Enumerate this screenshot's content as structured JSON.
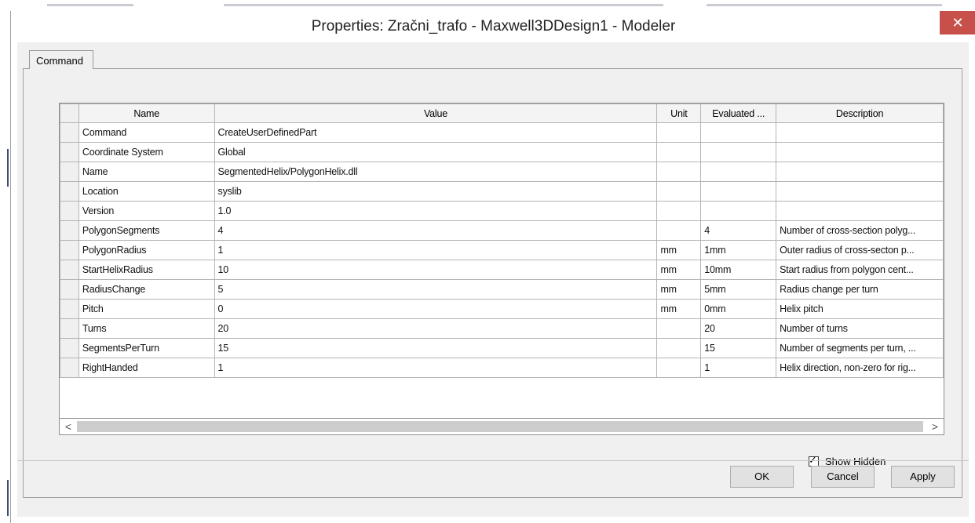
{
  "window": {
    "title": "Properties: Zračni_trafo - Maxwell3DDesign1 - Modeler",
    "close_label": "✕"
  },
  "tabs": [
    {
      "label": "Command",
      "active": true
    }
  ],
  "grid": {
    "columns": [
      "Name",
      "Value",
      "Unit",
      "Evaluated ...",
      "Description"
    ],
    "rows": [
      {
        "name": "Command",
        "value": "CreateUserDefinedPart",
        "unit": "",
        "evaluated": "",
        "description": ""
      },
      {
        "name": "Coordinate System",
        "value": "Global",
        "unit": "",
        "evaluated": "",
        "description": ""
      },
      {
        "name": "Name",
        "value": "SegmentedHelix/PolygonHelix.dll",
        "unit": "",
        "evaluated": "",
        "description": ""
      },
      {
        "name": "Location",
        "value": "syslib",
        "unit": "",
        "evaluated": "",
        "description": ""
      },
      {
        "name": "Version",
        "value": "1.0",
        "unit": "",
        "evaluated": "",
        "description": ""
      },
      {
        "name": "PolygonSegments",
        "value": "4",
        "unit": "",
        "evaluated": "4",
        "description": "Number of cross-section polyg..."
      },
      {
        "name": "PolygonRadius",
        "value": "1",
        "unit": "mm",
        "evaluated": "1mm",
        "description": "Outer radius of cross-secton p..."
      },
      {
        "name": "StartHelixRadius",
        "value": "10",
        "unit": "mm",
        "evaluated": "10mm",
        "description": "Start radius from polygon cent..."
      },
      {
        "name": "RadiusChange",
        "value": "5",
        "unit": "mm",
        "evaluated": "5mm",
        "description": "Radius change per turn"
      },
      {
        "name": "Pitch",
        "value": "0",
        "unit": "mm",
        "evaluated": "0mm",
        "description": "Helix pitch"
      },
      {
        "name": "Turns",
        "value": "20",
        "unit": "",
        "evaluated": "20",
        "description": "Number of turns"
      },
      {
        "name": "SegmentsPerTurn",
        "value": "15",
        "unit": "",
        "evaluated": "15",
        "description": "Number of segments per turn, ..."
      },
      {
        "name": "RightHanded",
        "value": "1",
        "unit": "",
        "evaluated": "1",
        "description": "Helix direction, non-zero for rig..."
      }
    ]
  },
  "scrollbar": {
    "left_arrow": "<",
    "right_arrow": ">"
  },
  "show_hidden": {
    "label": "Show Hidden",
    "checked": true
  },
  "buttons": {
    "ok": "OK",
    "cancel": "Cancel",
    "apply": "Apply"
  },
  "colors": {
    "close_button": "#c7504a",
    "dialog_bg": "#f0f0f0"
  }
}
